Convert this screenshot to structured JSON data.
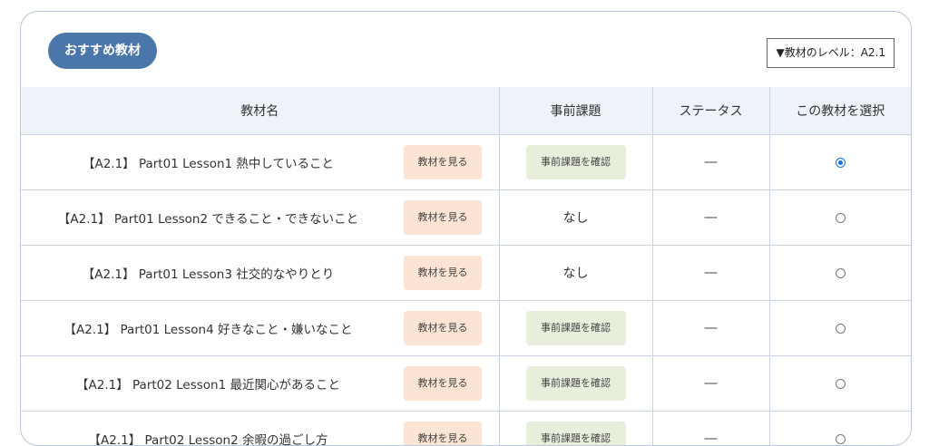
{
  "header": {
    "badge_label": "おすすめ教材",
    "level_button": "▼教材のレベル：A2.1"
  },
  "table": {
    "columns": [
      "教材名",
      "事前課題",
      "ステータス",
      "この教材を選択"
    ],
    "rows": [
      {
        "title": "【A2.1】 Part01 Lesson1 熱中していること",
        "view": "教材を見る",
        "task": "事前課題を確認",
        "task_type": "button",
        "status": "―",
        "selected": true
      },
      {
        "title": "【A2.1】 Part01 Lesson2 できること・できないこと",
        "view": "教材を見る",
        "task": "なし",
        "task_type": "text",
        "status": "―",
        "selected": false
      },
      {
        "title": "【A2.1】 Part01 Lesson3 社交的なやりとり",
        "view": "教材を見る",
        "task": "なし",
        "task_type": "text",
        "status": "―",
        "selected": false
      },
      {
        "title": "【A2.1】 Part01 Lesson4 好きなこと・嫌いなこと",
        "view": "教材を見る",
        "task": "事前課題を確認",
        "task_type": "button",
        "status": "―",
        "selected": false
      },
      {
        "title": "【A2.1】 Part02 Lesson1 最近関心があること",
        "view": "教材を見る",
        "task": "事前課題を確認",
        "task_type": "button",
        "status": "―",
        "selected": false
      },
      {
        "title": "【A2.1】 Part02 Lesson2 余暇の過ごし方",
        "view": "教材を見る",
        "task": "事前課題を確認",
        "task_type": "button",
        "status": "―",
        "selected": false
      }
    ]
  },
  "colors": {
    "badge": "#4a76a9",
    "header_bg": "#eef3fa",
    "view_button": "#fbe4d4",
    "task_button": "#e7efdc",
    "radio_selected": "#1a6ee6"
  }
}
